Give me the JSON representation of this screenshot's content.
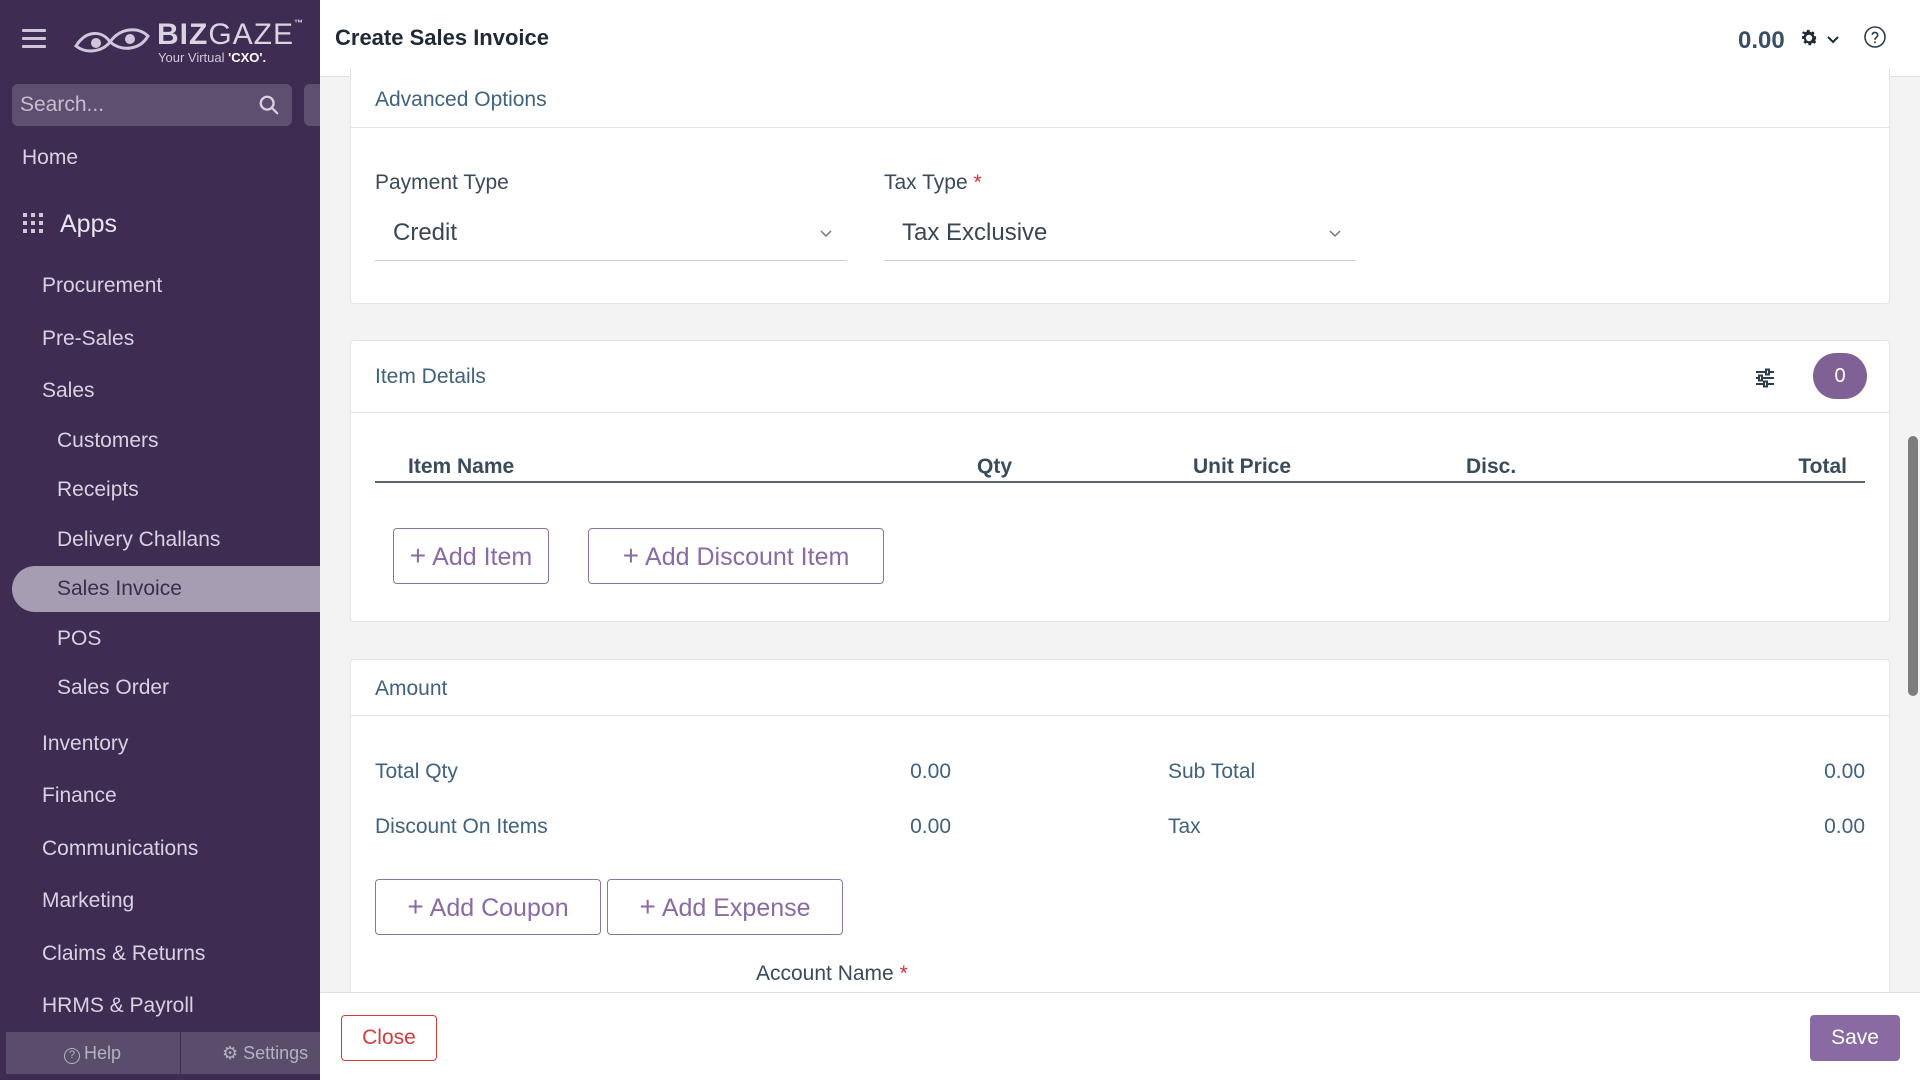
{
  "sidebar": {
    "logo": {
      "brand_bold": "BIZ",
      "brand_thin": "GAZE",
      "tm": "™",
      "tagline_prefix": "Your Virtual ",
      "tagline_bold": "'CXO'."
    },
    "search": {
      "placeholder": "Search..."
    },
    "home": "Home",
    "apps": "Apps",
    "items": [
      {
        "label": "Procurement"
      },
      {
        "label": "Pre-Sales"
      },
      {
        "label": "Sales"
      },
      {
        "label": "Customers"
      },
      {
        "label": "Receipts"
      },
      {
        "label": "Delivery Challans"
      },
      {
        "label": "Sales Invoice"
      },
      {
        "label": "POS"
      },
      {
        "label": "Sales Order"
      },
      {
        "label": "Inventory"
      },
      {
        "label": "Finance"
      },
      {
        "label": "Communications"
      },
      {
        "label": "Marketing"
      },
      {
        "label": "Claims & Returns"
      },
      {
        "label": "HRMS & Payroll"
      }
    ],
    "footer": {
      "help": "Help",
      "settings": "Settings"
    }
  },
  "header": {
    "title": "Create Sales Invoice",
    "amount": "0.00"
  },
  "advanced": {
    "title": "Advanced Options",
    "payment_type": {
      "label": "Payment Type",
      "value": "Credit"
    },
    "tax_type": {
      "label": "Tax Type",
      "required": "*",
      "value": "Tax Exclusive"
    }
  },
  "items": {
    "title": "Item Details",
    "count": "0",
    "columns": [
      "Item Name",
      "Qty",
      "Unit Price",
      "Disc.",
      "Total"
    ],
    "add_item": "Add Item",
    "add_discount_item": "Add Discount Item",
    "plus": "+"
  },
  "amount": {
    "title": "Amount",
    "total_qty": {
      "label": "Total Qty",
      "value": "0.00"
    },
    "discount_on_items": {
      "label": "Discount On Items",
      "value": "0.00"
    },
    "sub_total": {
      "label": "Sub Total",
      "value": "0.00"
    },
    "tax": {
      "label": "Tax",
      "value": "0.00"
    },
    "add_coupon": "Add Coupon",
    "add_expense": "Add Expense",
    "account_name": {
      "label": "Account Name",
      "required": "*"
    }
  },
  "footer": {
    "close": "Close",
    "save": "Save"
  },
  "colors": {
    "sidebar_bg": "#3e2c53",
    "accent": "#8a6aa3",
    "danger": "#d43b3b",
    "text": "#40627e"
  }
}
